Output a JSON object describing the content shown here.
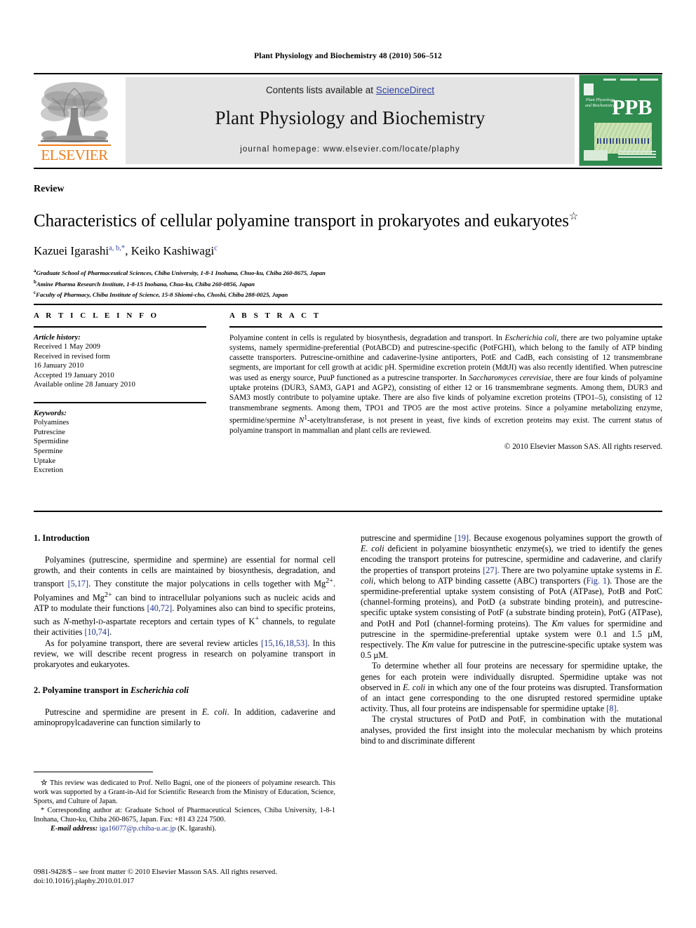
{
  "running_head": "Plant Physiology and Biochemistry 48 (2010) 506–512",
  "masthead": {
    "contents_prefix": "Contents lists available at ",
    "sciencedirect": "ScienceDirect",
    "journal_title": "Plant Physiology and Biochemistry",
    "homepage": "journal homepage: www.elsevier.com/locate/plaphy",
    "elsevier_wordmark": "ELSEVIER",
    "cover_acronym": "PPB",
    "cover_journal_name": "Plant Physiology and Biochemistry",
    "link_color": "#2b3f9e",
    "cover_color": "#2f8b4e",
    "band_color": "#e4e4e4",
    "elsevier_orange": "#ef7d1a"
  },
  "article": {
    "doctype": "Review",
    "title": "Characteristics of cellular polyamine transport in prokaryotes and eukaryotes",
    "title_marker": "☆",
    "authors": "Kazuei Igarashi, Keiko Kashiwagi",
    "author_1": "Kazuei Igarashi",
    "author_1_sup": "a, b,*",
    "author_2": "Keiko Kashiwagi",
    "author_2_sup": "c",
    "affiliations": [
      {
        "marker": "a",
        "text": "Graduate School of Pharmaceutical Sciences, Chiba University, 1-8-1 Inohana, Chuo-ku, Chiba 260-8675, Japan"
      },
      {
        "marker": "b",
        "text": "Amine Pharma Research Institute, 1-8-15 Inohana, Chuo-ku, Chiba 260-0856, Japan"
      },
      {
        "marker": "c",
        "text": "Faculty of Pharmacy, Chiba Institute of Science, 15-8 Shiomi-cho, Choshi, Chiba 288-0025, Japan"
      }
    ]
  },
  "article_info": {
    "heading": "A R T I C L E  I N F O",
    "history_label": "Article history:",
    "history": [
      "Received 1 May 2009",
      "Received in revised form",
      "16 January 2010",
      "Accepted 19 January 2010",
      "Available online 28 January 2010"
    ],
    "keywords_label": "Keywords:",
    "keywords": [
      "Polyamines",
      "Putrescine",
      "Spermidine",
      "Spermine",
      "Uptake",
      "Excretion"
    ]
  },
  "abstract": {
    "heading": "A B S T R A C T",
    "paragraph_html": "Polyamine content in cells is regulated by biosynthesis, degradation and transport. In <i>Escherichia coli</i>, there are two polyamine uptake systems, namely spermidine-preferential (PotABCD) and putrescine-specific (PotFGHI), which belong to the family of ATP binding cassette transporters. Putrescine-ornithine and cadaverine-lysine antiporters, PotE and CadB, each consisting of 12 transmembrane segments, are important for cell growth at acidic pH. Spermidine excretion protein (MdtJI) was also recently identified. When putrescine was used as energy source, PuuP functioned as a putrescine transporter. In <i>Saccharomyces cerevisiae</i>, there are four kinds of polyamine uptake proteins (DUR3, SAM3, GAP1 and AGP2), consisting of either 12 or 16 transmembrane segments. Among them, DUR3 and SAM3 mostly contribute to polyamine uptake. There are also five kinds of polyamine excretion proteins (TPO1–5), consisting of 12 transmembrane segments. Among them, TPO1 and TPO5 are the most active proteins. Since a polyamine metabolizing enzyme, spermidine/spermine <i>N</i><sup>1</sup>-acetyltransferase, is not present in yeast, five kinds of excretion proteins may exist. The current status of polyamine transport in mammalian and plant cells are reviewed.",
    "copyright": "© 2010 Elsevier Masson SAS. All rights reserved."
  },
  "body": {
    "left": {
      "section1_heading": "1. Introduction",
      "para1_html": "Polyamines (putrescine, spermidine and spermine) are essential for normal cell growth, and their contents in cells are maintained by biosynthesis, degradation, and transport <span class=\"ref\">[5,17]</span>. They constitute the major polycations in cells together with Mg<sup>2+</sup>. Polyamines and Mg<sup>2+</sup> can bind to intracellular polyanions such as nucleic acids and ATP to modulate their functions <span class=\"ref\">[40,72]</span>. Polyamines also can bind to specific proteins, such as <i>N</i>-methyl-<span class=\"scap\">d</span>-aspartate receptors and certain types of K<sup>+</sup> channels, to regulate their activities <span class=\"ref\">[10,74]</span>.",
      "para2_html": "As for polyamine transport, there are several review articles <span class=\"ref\">[15,16,18,53]</span>. In this review, we will describe recent progress in research on polyamine transport in prokaryotes and eukaryotes.",
      "section2_heading_html": "2. Polyamine transport in <i>Escherichia coli</i>",
      "para3_html": "Putrescine and spermidine are present in <i>E. coli</i>. In addition, cadaverine and aminopropylcadaverine can function similarly to"
    },
    "right": {
      "para1_html": "putrescine and spermidine <span class=\"ref\">[19]</span>. Because exogenous polyamines support the growth of <i>E. coli</i> deficient in polyamine biosynthetic enzyme(s), we tried to identify the genes encoding the transport proteins for putrescine, spermidine and cadaverine, and clarify the properties of transport proteins <span class=\"ref\">[27]</span>. There are two polyamine uptake systems in <i>E. coli</i>, which belong to ATP binding cassette (ABC) transporters (<span class=\"ref\">Fig. 1</span>). Those are the spermidine-preferential uptake system consisting of PotA (ATPase), PotB and PotC (channel-forming proteins), and PotD (a substrate binding protein), and putrescine-specific uptake system consisting of PotF (a substrate binding protein), PotG (ATPase), and PotH and PotI (channel-forming proteins). The <i>Km</i> values for spermidine and putrescine in the spermidine-preferential uptake system were 0.1 and 1.5 µM, respectively. The <i>Km</i> value for putrescine in the putrescine-specific uptake system was 0.5 µM.",
      "para2_html": "To determine whether all four proteins are necessary for spermidine uptake, the genes for each protein were individually disrupted. Spermidine uptake was not observed in <i>E. coli</i> in which any one of the four proteins was disrupted. Transformation of an intact gene corresponding to the one disrupted restored spermidine uptake activity. Thus, all four proteins are indispensable for spermidine uptake <span class=\"ref\">[8]</span>.",
      "para3_html": "The crystal structures of PotD and PotF, in combination with the mutational analyses, provided the first insight into the molecular mechanism by which proteins bind to and discriminate different"
    }
  },
  "footnotes": {
    "dedication_html": "<span style=\"font-weight:bold\">☆</span> This review was dedicated to Prof. Nello Bagni, one of the pioneers of polyamine research. This work was supported by a Grant-in-Aid for Scientific Research from the Ministry of Education, Science, Sports, and Culture of Japan.",
    "corresponding_html": "* Corresponding author at: Graduate School of Pharmaceutical Sciences, Chiba University, 1-8-1 Inohana, Chuo-ku, Chiba 260-8675, Japan. Fax: +81 43 224 7500.",
    "email_label": "E-mail address:",
    "email": "iga16077@p.chiba-u.ac.jp",
    "email_owner": "(K. Igarashi)."
  },
  "imprint": {
    "issn_line": "0981-9428/$ – see front matter © 2010 Elsevier Masson SAS. All rights reserved.",
    "doi_line": "doi:10.1016/j.plaphy.2010.01.017"
  }
}
